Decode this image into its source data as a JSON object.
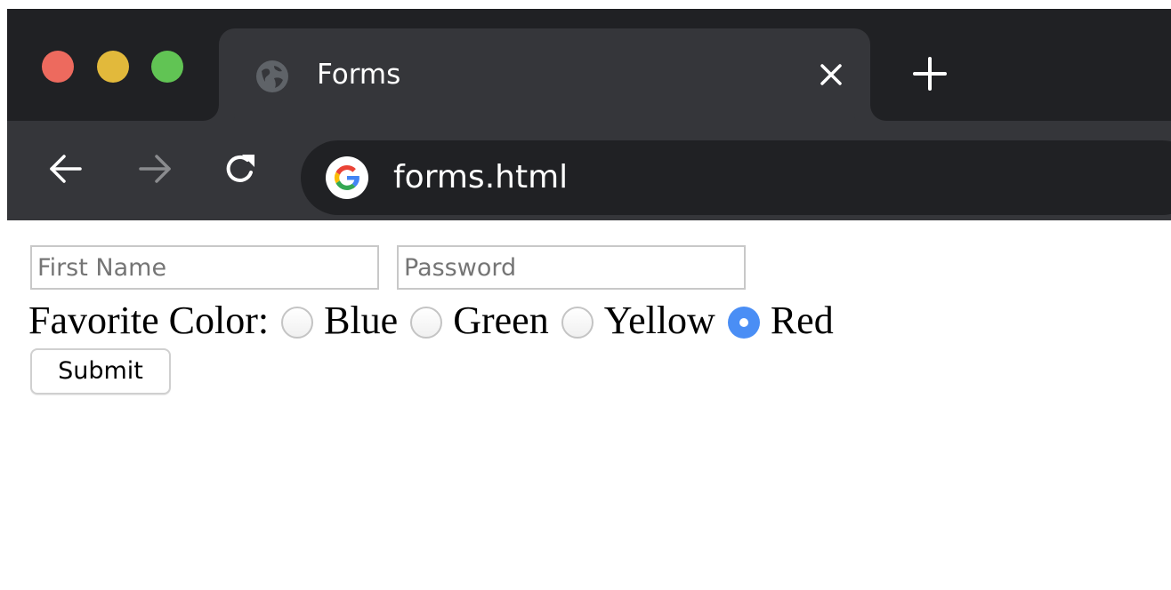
{
  "window": {
    "traffic_lights": {
      "close_color": "#ed6a5e",
      "minimize_color": "#e2b93b",
      "zoom_color": "#61c454"
    }
  },
  "tab": {
    "title": "Forms",
    "favicon": "globe-icon",
    "close_icon": "close-icon",
    "new_tab_icon": "plus-icon"
  },
  "toolbar": {
    "back_icon": "arrow-left-icon",
    "forward_icon": "arrow-right-icon",
    "reload_icon": "reload-icon",
    "address": "forms.html",
    "address_icon": "google-g-icon"
  },
  "form": {
    "first_name": {
      "value": "",
      "placeholder": "First Name"
    },
    "password": {
      "value": "",
      "placeholder": "Password"
    },
    "favorite_color": {
      "label": "Favorite Color:",
      "options": [
        {
          "label": "Blue",
          "checked": false
        },
        {
          "label": "Green",
          "checked": false
        },
        {
          "label": "Yellow",
          "checked": false
        },
        {
          "label": "Red",
          "checked": true
        }
      ],
      "selected": "Red"
    },
    "submit_label": "Submit"
  },
  "colors": {
    "tab_strip": "#202124",
    "toolbar": "#35363a",
    "radio_checked": "#4a8ef5"
  }
}
